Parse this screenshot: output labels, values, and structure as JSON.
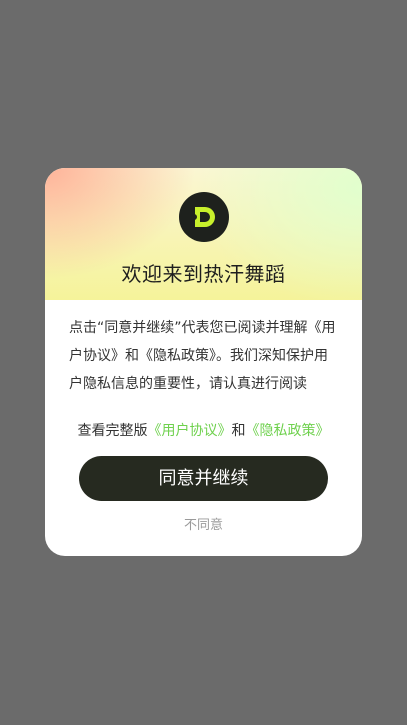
{
  "dialog": {
    "title": "欢迎来到热汗舞蹈",
    "logo_icon": "dance-logo-icon",
    "body_text": "点击“同意并继续”代表您已阅读并理解《用户协议》和《隐私政策》。我们深知保护用户隐私信息的重要性，请认真进行阅读",
    "links_prefix": "查看完整版",
    "user_agreement_link": "《用户协议》",
    "links_and": "和",
    "privacy_policy_link": "《隐私政策》",
    "agree_button": "同意并继续",
    "disagree_button": "不同意"
  },
  "colors": {
    "overlay": "#6b6b6b",
    "link": "#6fd14e",
    "button_bg": "#262a20",
    "logo_accent": "#c8f02c"
  }
}
